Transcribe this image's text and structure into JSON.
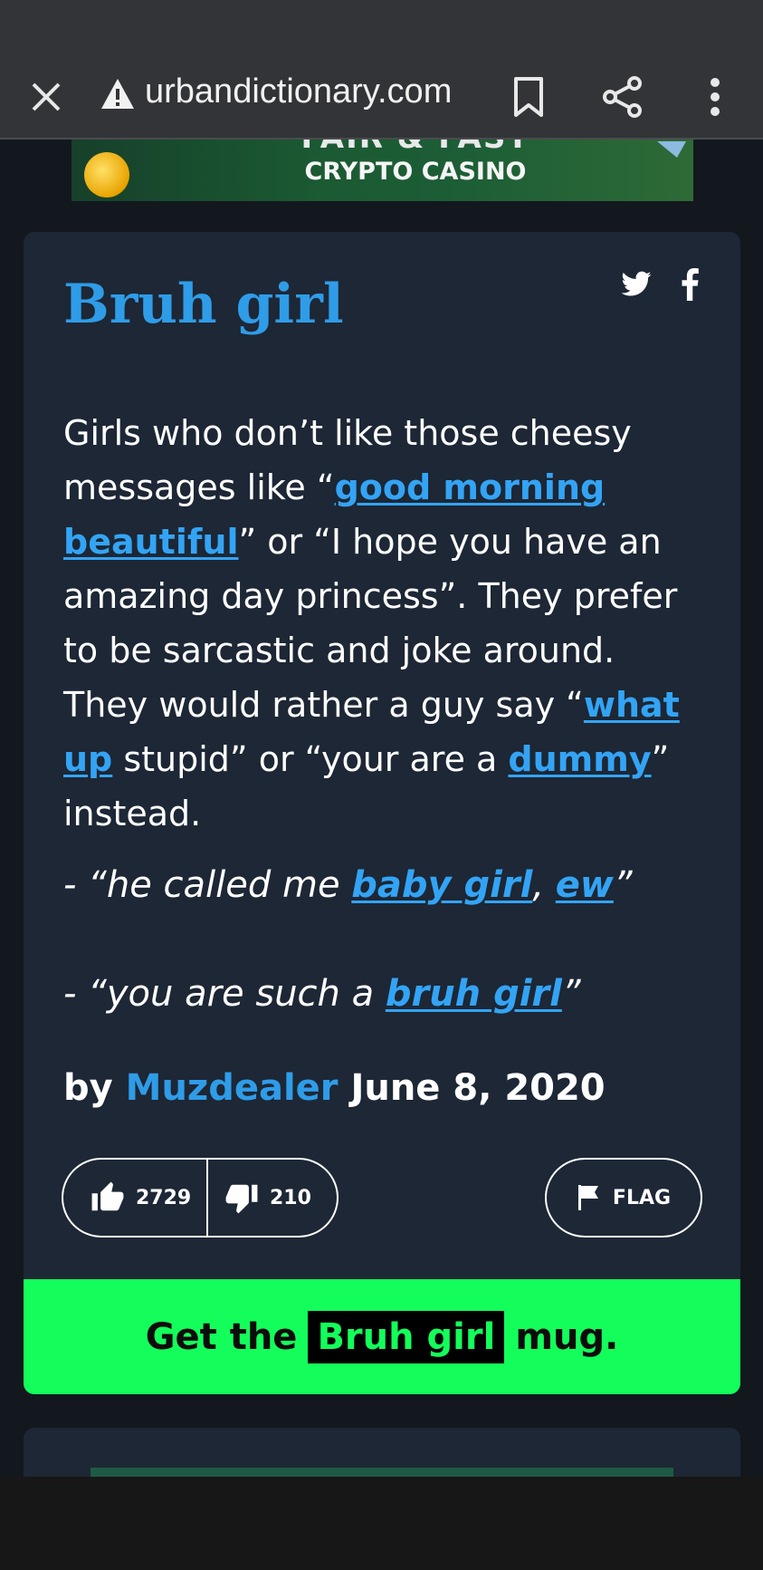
{
  "browser": {
    "domain": "urbandictionary.com",
    "icons": [
      "close-icon",
      "warning-icon",
      "bookmark-icon",
      "share-icon",
      "more-vert-icon"
    ]
  },
  "ad": {
    "headline": "FAIR & FAST",
    "subline": "CRYPTO CASINO"
  },
  "definition": {
    "word": "Bruh girl",
    "meaning_parts": {
      "p1": "Girls who don’t like those cheesy messages like “",
      "link1": "good morning beautiful",
      "p2": "” or “I hope you have an amazing day princess”. They prefer to be sarcastic and joke around. They would rather a guy say “",
      "link2": "what up",
      "p3": " stupid” or “your are a ",
      "link3": "dummy",
      "p4": "” instead."
    },
    "example1": {
      "pre": "- “he called me ",
      "link1": "baby girl",
      "mid": ", ",
      "link2": "ew",
      "post": "”"
    },
    "example2": {
      "pre": "- “you are such a ",
      "link": "bruh girl",
      "post": "”"
    },
    "by_label": "by ",
    "author": "Muzdealer",
    "date": "June 8, 2020",
    "thumbs_up": "2729",
    "thumbs_down": "210",
    "flag_label": "FLAG"
  },
  "mug": {
    "pre": "Get the",
    "word": "Bruh girl",
    "post": "mug."
  },
  "colors": {
    "background": "#13181f",
    "card": "#1d2735",
    "accent_blue": "#2f9ce8",
    "mug_green": "#13fe5a"
  }
}
